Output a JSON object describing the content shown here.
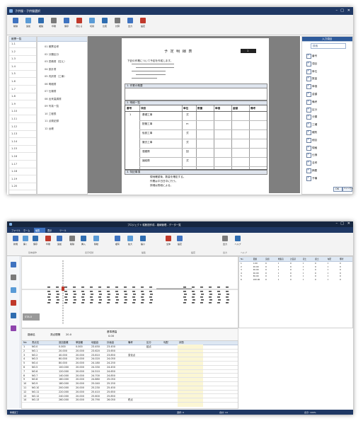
{
  "top": {
    "title": "子供服・子供服選択",
    "ribbon": {
      "buttons": [
        "削除",
        "追加",
        "複製",
        "印刷",
        "保存",
        "閉じる",
        "切替",
        "比較",
        "計算",
        "出力",
        "設定"
      ],
      "groups": [
        "編集",
        "表示",
        "出力",
        "設定"
      ]
    },
    "left": {
      "header": "帳票一覧",
      "rows": [
        "1-1",
        "1-2",
        "1-3",
        "1-4",
        "1-5",
        "1-6",
        "1-7",
        "1-8",
        "1-9",
        "1-10",
        "1-11",
        "1-12",
        "1-13",
        "1-14",
        "1-15",
        "1-16",
        "1-17",
        "1-18",
        "1-19",
        "1-20"
      ]
    },
    "list": {
      "items": [
        "01 帳票名称",
        "02 分類区分",
        "03 見積書（控え）",
        "04 設計書",
        "05 内訳書（工事）",
        "06 明細書",
        "07 仕様書",
        "08 出来高調書",
        "09 写真一覧",
        "10 工程表",
        "11 点検記録",
        "12 台帳"
      ]
    },
    "doc": {
      "title": "予 定 明 細 表",
      "box": "1",
      "intro": "下記の作業について予定を作成します。",
      "section1": "1. 作業の概要",
      "section2": "2. 明細一覧",
      "table_headers": [
        "番号",
        "項目",
        "単位",
        "数量",
        "単価",
        "金額",
        "備考"
      ],
      "rows": [
        {
          "no": "1",
          "item": "基礎工事",
          "unit": "式"
        },
        {
          "no": "",
          "item": "配管工事",
          "unit": "m"
        },
        {
          "no": "",
          "item": "仮設工事",
          "unit": "式"
        },
        {
          "no": "",
          "item": "撤去工事",
          "unit": "式"
        },
        {
          "no": "",
          "item": "運搬費",
          "unit": "回"
        },
        {
          "no": "",
          "item": "諸経費",
          "unit": "式"
        }
      ],
      "section3": "3. 特記事項",
      "notes": [
        "現地確認後、数量を確定する。",
        "作業は平日日中に行う。",
        "詳細は別紙による。"
      ]
    },
    "right": {
      "header": "入力項目",
      "search": "検索",
      "items": [
        {
          "label": "番号",
          "on": true
        },
        {
          "label": "項目",
          "on": true
        },
        {
          "label": "単位",
          "on": true
        },
        {
          "label": "数量",
          "on": true
        },
        {
          "label": "単価",
          "on": true
        },
        {
          "label": "金額",
          "on": true
        },
        {
          "label": "備考",
          "on": true
        },
        {
          "label": "区分",
          "on": true
        },
        {
          "label": "分類",
          "on": true
        },
        {
          "label": "工種",
          "on": true
        },
        {
          "label": "種別",
          "on": true
        },
        {
          "label": "細目",
          "on": true
        },
        {
          "label": "規格",
          "on": true
        },
        {
          "label": "仕様",
          "on": true
        },
        {
          "label": "名称",
          "on": true
        },
        {
          "label": "摘要",
          "on": true
        },
        {
          "label": "予備",
          "on": true
        }
      ],
      "ok": "OK",
      "cancel": "キャンセル"
    }
  },
  "bottom": {
    "title": "プロジェクト 縦断図作成 - 路線管理 - データ一覧",
    "tabs": [
      "ファイル",
      "ホーム",
      "編集",
      "表示",
      "ツール"
    ],
    "active_tab": "編集",
    "ribbon_groups": [
      "基本操作",
      "表示切替",
      "編集",
      "設定",
      "出力",
      "ヘルプ"
    ],
    "ribbon_buttons": [
      "新規",
      "開く",
      "保存",
      "印刷",
      "追加",
      "削除",
      "挿入",
      "移動",
      "複写",
      "拡大",
      "縮小",
      "全体",
      "設定",
      "出力",
      "ヘルプ"
    ],
    "side_icons": [
      "home",
      "route",
      "chart",
      "filter",
      "edit",
      "graph"
    ],
    "chart_label": "STA.0",
    "right_table": {
      "headers": [
        "No",
        "距離",
        "追加",
        "地盤高",
        "計画高",
        "切土",
        "盛土",
        "勾配",
        "備考"
      ],
      "rows": [
        [
          "1",
          "0.00",
          "0",
          "0",
          "0",
          "0",
          "0",
          "0",
          "0"
        ],
        [
          "2",
          "20.00",
          "0",
          "0",
          "0",
          "0",
          "0",
          "0",
          "0"
        ],
        [
          "3",
          "40.00",
          "0",
          "0",
          "0",
          "0",
          "0",
          "0",
          "0"
        ],
        [
          "4",
          "60.00",
          "0",
          "0",
          "0",
          "0",
          "0",
          "0",
          "0"
        ],
        [
          "5",
          "80.00",
          "0",
          "0",
          "0",
          "0",
          "0",
          "0",
          "0"
        ],
        [
          "6",
          "100.00",
          "0",
          "0",
          "0",
          "0",
          "0",
          "0",
          "0"
        ]
      ]
    },
    "form": {
      "label1": "路線名",
      "label2": "測点間隔",
      "value2": "20.0",
      "label3": "基準標高",
      "value3": "0.00"
    },
    "grid": {
      "headers": [
        "No",
        "測点名",
        "追加距離",
        "単距離",
        "地盤高",
        "計画高",
        "備考",
        "区分",
        "勾配",
        "状態"
      ],
      "rows": [
        [
          "1",
          "NO.0",
          "0.000",
          "0.000",
          "23.450",
          "23.450",
          "",
          "起点",
          "",
          ""
        ],
        [
          "2",
          "NO.1",
          "20.000",
          "20.000",
          "23.620",
          "23.650",
          "",
          "",
          "",
          ""
        ],
        [
          "3",
          "NO.2",
          "40.000",
          "20.000",
          "23.810",
          "23.850",
          "変化点",
          "",
          "",
          ""
        ],
        [
          "4",
          "NO.3",
          "60.000",
          "20.000",
          "24.020",
          "24.050",
          "",
          "",
          "",
          ""
        ],
        [
          "5",
          "NO.4",
          "80.000",
          "20.000",
          "24.180",
          "24.250",
          "",
          "",
          "",
          ""
        ],
        [
          "6",
          "NO.5",
          "100.000",
          "20.000",
          "24.330",
          "24.450",
          "",
          "",
          "",
          ""
        ],
        [
          "7",
          "NO.6",
          "120.000",
          "20.000",
          "24.510",
          "24.650",
          "",
          "",
          "",
          ""
        ],
        [
          "8",
          "NO.7",
          "140.000",
          "20.000",
          "24.700",
          "24.850",
          "",
          "",
          "",
          ""
        ],
        [
          "9",
          "NO.8",
          "160.000",
          "20.000",
          "24.880",
          "25.050",
          "",
          "",
          "",
          ""
        ],
        [
          "10",
          "NO.9",
          "180.000",
          "20.000",
          "25.040",
          "25.250",
          "",
          "",
          "",
          ""
        ],
        [
          "11",
          "NO.10",
          "200.000",
          "20.000",
          "25.230",
          "25.450",
          "",
          "",
          "",
          ""
        ],
        [
          "12",
          "NO.11",
          "220.000",
          "20.000",
          "25.410",
          "25.650",
          "",
          "",
          "",
          ""
        ],
        [
          "13",
          "NO.12",
          "240.000",
          "20.000",
          "25.600",
          "25.850",
          "",
          "",
          "",
          ""
        ],
        [
          "14",
          "NO.13",
          "260.000",
          "20.000",
          "25.790",
          "26.050",
          "終点",
          "",
          "",
          ""
        ]
      ]
    },
    "status": [
      "準備完了",
      "選択: 0",
      "合計: 14",
      "表示: 100%"
    ]
  }
}
